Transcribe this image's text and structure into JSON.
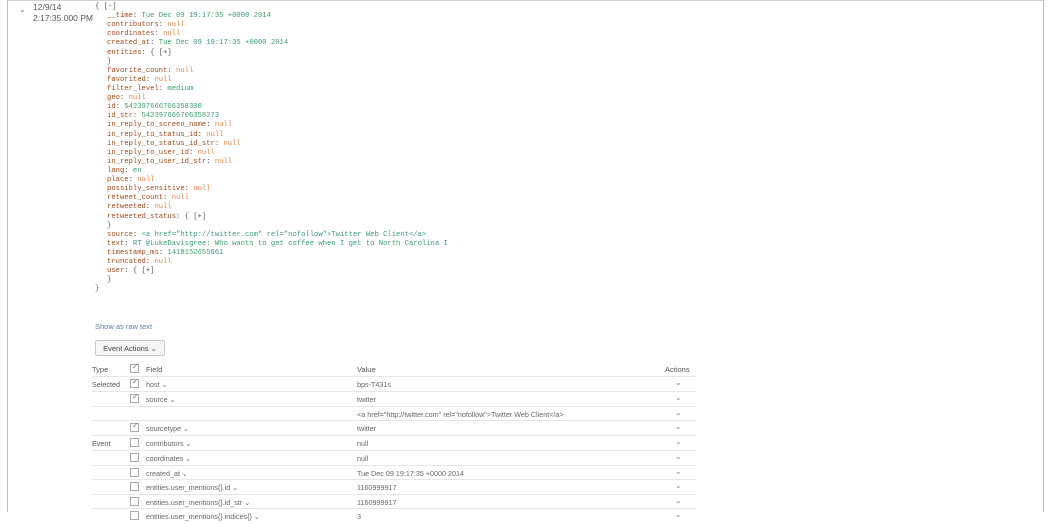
{
  "event": {
    "expand_glyph": "⌄",
    "date": "12/9/14",
    "time": "2:17:35.000 PM"
  },
  "json_lines": [
    {
      "k": "",
      "v": "{ [-]",
      "t": "br",
      "i": 0
    },
    {
      "k": "__time",
      "v": "Tue Dec 09 19:17:35 +0000 2014",
      "t": "str",
      "i": 1
    },
    {
      "k": "contributors",
      "v": "null",
      "t": "null",
      "i": 1
    },
    {
      "k": "coordinates",
      "v": "null",
      "t": "null",
      "i": 1
    },
    {
      "k": "created_at",
      "v": "Tue Dec 09 19:17:35 +0000 2014",
      "t": "str",
      "i": 1
    },
    {
      "k": "entities",
      "v": "{ [+]",
      "t": "br",
      "i": 1
    },
    {
      "k": "",
      "v": "}",
      "t": "br",
      "i": 1
    },
    {
      "k": "favorite_count",
      "v": "null",
      "t": "null",
      "i": 1
    },
    {
      "k": "favorited",
      "v": "null",
      "t": "null",
      "i": 1
    },
    {
      "k": "filter_level",
      "v": "medium",
      "t": "str",
      "i": 1
    },
    {
      "k": "geo",
      "v": "null",
      "t": "null",
      "i": 1
    },
    {
      "k": "id",
      "v": "542397666706358300",
      "t": "num",
      "i": 1
    },
    {
      "k": "id_str",
      "v": "542397666706358273",
      "t": "num",
      "i": 1
    },
    {
      "k": "in_reply_to_screen_name",
      "v": "null",
      "t": "null",
      "i": 1
    },
    {
      "k": "in_reply_to_status_id",
      "v": "null",
      "t": "null",
      "i": 1
    },
    {
      "k": "in_reply_to_status_id_str",
      "v": "null",
      "t": "null",
      "i": 1
    },
    {
      "k": "in_reply_to_user_id",
      "v": "null",
      "t": "null",
      "i": 1
    },
    {
      "k": "in_reply_to_user_id_str",
      "v": "null",
      "t": "null",
      "i": 1
    },
    {
      "k": "lang",
      "v": "en",
      "t": "str",
      "i": 1
    },
    {
      "k": "place",
      "v": "null",
      "t": "null",
      "i": 1
    },
    {
      "k": "possibly_sensitive",
      "v": "null",
      "t": "null",
      "i": 1
    },
    {
      "k": "retweet_count",
      "v": "null",
      "t": "null",
      "i": 1
    },
    {
      "k": "retweeted",
      "v": "null",
      "t": "null",
      "i": 1
    },
    {
      "k": "retweeted_status",
      "v": "{ [+]",
      "t": "br",
      "i": 1
    },
    {
      "k": "",
      "v": "}",
      "t": "br",
      "i": 1
    },
    {
      "k": "source",
      "v": "<a href=\"http://twitter.com\" rel=\"nofollow\">Twitter Web Client</a>",
      "t": "str",
      "i": 1
    },
    {
      "k": "text",
      "v": "RT @LukeDavisgree: Who wants to get coffee when I get to North Carolina I",
      "t": "str",
      "i": 1
    },
    {
      "k": "timestamp_ms",
      "v": "1418152655661",
      "t": "num",
      "i": 1
    },
    {
      "k": "truncated",
      "v": "null",
      "t": "null",
      "i": 1
    },
    {
      "k": "user",
      "v": "{ [+]",
      "t": "br",
      "i": 1
    },
    {
      "k": "",
      "v": "}",
      "t": "br",
      "i": 1
    },
    {
      "k": "",
      "v": "}",
      "t": "br",
      "i": 0
    }
  ],
  "show_raw_text": "Show as raw text",
  "event_actions_label": "Event Actions ⌄",
  "table": {
    "headers": {
      "type": "Type",
      "field": "Field",
      "value": "Value",
      "actions": "Actions"
    },
    "rows": [
      {
        "type": "Selected",
        "checked": true,
        "field": "host ⌄",
        "value": "bps-T431s"
      },
      {
        "type": "",
        "checked": true,
        "field": "source ⌄",
        "value": "twitter"
      },
      {
        "type": "",
        "checked": null,
        "field": "",
        "value": "<a href=\"http://twitter.com\" rel=\"nofollow\">Twitter Web Client</a>"
      },
      {
        "type": "",
        "checked": true,
        "field": "sourcetype ⌄",
        "value": "twitter"
      },
      {
        "type": "Event",
        "checked": false,
        "field": "contributors ⌄",
        "value": "null"
      },
      {
        "type": "",
        "checked": false,
        "field": "coordinates ⌄",
        "value": "null"
      },
      {
        "type": "",
        "checked": false,
        "field": "created_at ⌄",
        "value": "Tue Dec 09 19:17:35 +0000 2014"
      },
      {
        "type": "",
        "checked": false,
        "field": "entities.user_mentions{}.id ⌄",
        "value": "1160999917"
      },
      {
        "type": "",
        "checked": false,
        "field": "entities.user_mentions{}.id_str ⌄",
        "value": "1160999917"
      },
      {
        "type": "",
        "checked": false,
        "field": "entities.user_mentions{}.indices{} ⌄",
        "value": "3"
      }
    ],
    "chevron": "⌄"
  },
  "colors": {
    "key": "#a34a1c",
    "null": "#e1864a",
    "string": "#3a9d6e",
    "link": "#5a7fa8"
  }
}
